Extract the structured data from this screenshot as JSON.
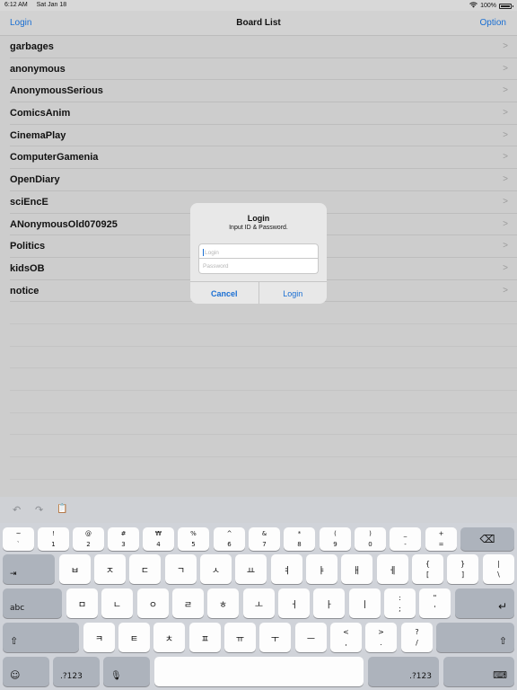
{
  "status_bar": {
    "time": "6:12 AM",
    "date": "Sat Jan 18",
    "battery": "100%"
  },
  "nav": {
    "left": "Login",
    "title": "Board List",
    "right": "Option"
  },
  "boards": [
    "garbages",
    "anonymous",
    "AnonymousSerious",
    "ComicsAnim",
    "CinemaPlay",
    "ComputerGamenia",
    "OpenDiary",
    "sciEncE",
    "ANonymousOld070925",
    "Politics",
    "kidsOB",
    "notice"
  ],
  "alert": {
    "title": "Login",
    "message": "Input ID & Password.",
    "login_placeholder": "Login",
    "password_placeholder": "Password",
    "cancel": "Cancel",
    "confirm": "Login"
  },
  "keyboard": {
    "toolbar": {
      "undo": "↶",
      "redo": "↷",
      "paste": "📋"
    },
    "row1": [
      {
        "top": "~",
        "bot": "`"
      },
      {
        "top": "!",
        "bot": "1"
      },
      {
        "top": "@",
        "bot": "2"
      },
      {
        "top": "#",
        "bot": "3"
      },
      {
        "top": "₩",
        "bot": "4"
      },
      {
        "top": "%",
        "bot": "5"
      },
      {
        "top": "^",
        "bot": "6"
      },
      {
        "top": "&",
        "bot": "7"
      },
      {
        "top": "*",
        "bot": "8"
      },
      {
        "top": "(",
        "bot": "9"
      },
      {
        "top": ")",
        "bot": "0"
      },
      {
        "top": "_",
        "bot": "-"
      },
      {
        "top": "+",
        "bot": "="
      }
    ],
    "row2": [
      "ㅂ",
      "ㅈ",
      "ㄷ",
      "ㄱ",
      "ㅅ",
      "ㅛ",
      "ㅕ",
      "ㅑ",
      "ㅐ",
      "ㅔ"
    ],
    "row2_extra": [
      {
        "top": "{",
        "bot": "["
      },
      {
        "top": "}",
        "bot": "]"
      },
      {
        "top": "|",
        "bot": "\\"
      }
    ],
    "row3": [
      "ㅁ",
      "ㄴ",
      "ㅇ",
      "ㄹ",
      "ㅎ",
      "ㅗ",
      "ㅓ",
      "ㅏ",
      "ㅣ"
    ],
    "row3_extra": [
      {
        "top": ":",
        "bot": ";"
      },
      {
        "top": "\"",
        "bot": "'"
      }
    ],
    "row4": [
      "ㅋ",
      "ㅌ",
      "ㅊ",
      "ㅍ",
      "ㅠ",
      "ㅜ",
      "ㅡ"
    ],
    "row4_extra": [
      {
        "top": "<",
        "bot": ","
      },
      {
        "top": ">",
        "bot": "."
      },
      {
        "top": "?",
        "bot": "/"
      }
    ],
    "tab": "⇥",
    "delete": "⌫",
    "caps": "abc",
    "return": "↵",
    "shift": "⇧",
    "emoji": "☺",
    "numbers": ".?123",
    "mic": "🎙",
    "hide": "⌨"
  }
}
